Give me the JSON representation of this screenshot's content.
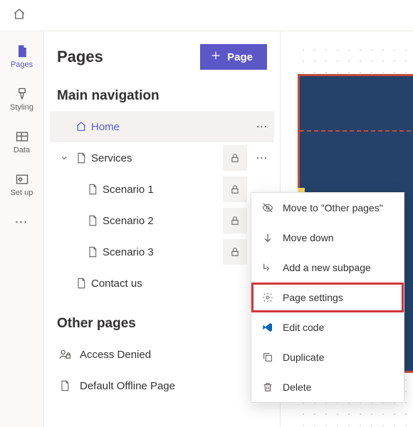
{
  "panel": {
    "title": "Pages",
    "new_button": "Page",
    "section_main": "Main navigation",
    "section_other": "Other pages"
  },
  "rail": {
    "pages": "Pages",
    "styling": "Styling",
    "data": "Data",
    "setup": "Set up"
  },
  "tree": {
    "home": "Home",
    "services": "Services",
    "scenario1": "Scenario 1",
    "scenario2": "Scenario 2",
    "scenario3": "Scenario 3",
    "contact": "Contact us"
  },
  "other": {
    "access_denied": "Access Denied",
    "offline": "Default Offline Page"
  },
  "menu": {
    "move_other": "Move to \"Other pages\"",
    "move_down": "Move down",
    "add_sub": "Add a new subpage",
    "settings": "Page settings",
    "edit_code": "Edit code",
    "duplicate": "Duplicate",
    "delete": "Delete"
  }
}
